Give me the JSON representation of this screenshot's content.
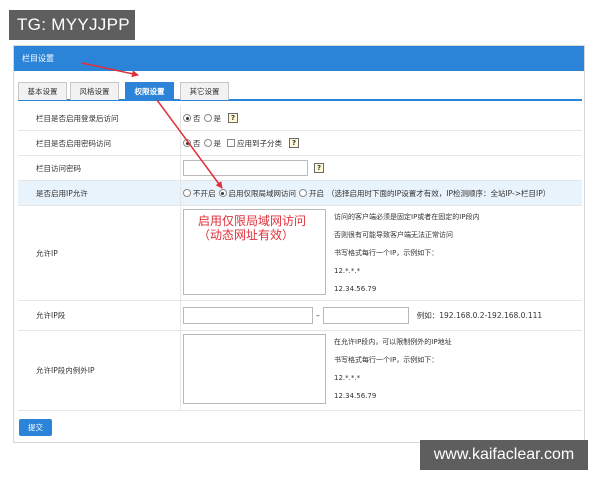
{
  "badge": {
    "text": "TG: MYYJJPP"
  },
  "panel": {
    "title": "栏目设置"
  },
  "tabs": [
    {
      "label": "基本设置",
      "active": false
    },
    {
      "label": "风格设置",
      "active": false
    },
    {
      "label": "权限设置",
      "active": true
    },
    {
      "label": "其它设置",
      "active": false
    }
  ],
  "rows": {
    "login": {
      "label": "栏目是否启用登录后访问",
      "options": [
        {
          "label": "否",
          "checked": true
        },
        {
          "label": "是",
          "checked": false
        }
      ],
      "help": "?"
    },
    "password": {
      "label": "栏目是否启用密码访问",
      "options": [
        {
          "label": "否",
          "checked": true
        },
        {
          "label": "是",
          "checked": false
        }
      ],
      "apply_sub": "应用到子分类",
      "help": "?"
    },
    "access_pwd": {
      "label": "栏目访问密码",
      "value": "",
      "help": "?"
    },
    "ip_allow": {
      "label": "是否启用IP允许",
      "options": [
        {
          "label": "不开启",
          "checked": false
        },
        {
          "label": "启用仅限局域网访问",
          "checked": true
        },
        {
          "label": "开启",
          "checked": false
        }
      ],
      "note": "（选择启用时下面的IP设置才有效，IP检测顺序：全站IP->栏目IP）"
    },
    "allow_ip": {
      "label": "允许IP",
      "annotation_line1": "启用仅限局域网访问",
      "annotation_line2": "（动态网址有效）",
      "hints": [
        "访问的客户端必须是固定IP或者在固定的IP段内",
        "否则很有可能导致客户端无法正常访问",
        "书写格式每行一个IP，示例如下：",
        "12.*.*.*",
        "12.34.56.79"
      ]
    },
    "allow_range": {
      "label": "允许IP段",
      "separator": "–",
      "example": "例如：192.168.0.2-192.168.0.111"
    },
    "allow_exceptions": {
      "label": "允许IP段内例外IP",
      "hints": [
        "在允许IP段内，可以限制例外的IP地址",
        "书写格式每行一个IP，示例如下：",
        "12.*.*.*",
        "12.34.56.79"
      ]
    }
  },
  "submit": {
    "label": "提交"
  },
  "watermark": {
    "text": "www.kaifaclear.com"
  },
  "colors": {
    "accent": "#2b84d8",
    "annotation": "#e0303a"
  }
}
